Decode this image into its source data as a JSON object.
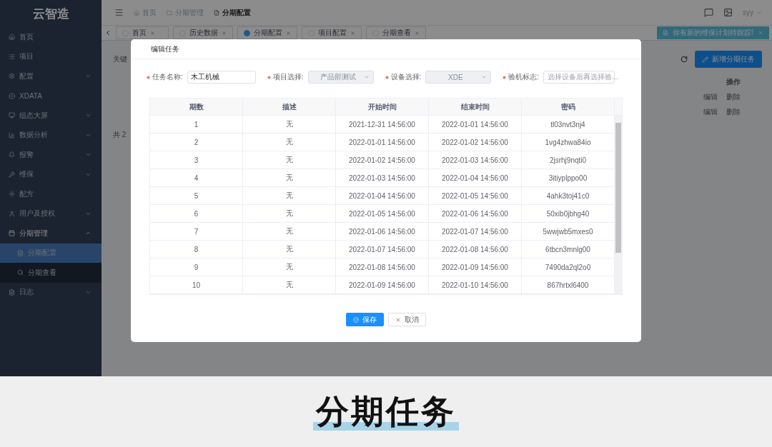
{
  "sidebar": {
    "logo": "云智造",
    "items": [
      {
        "label": "首页",
        "kind": "link"
      },
      {
        "label": "项目",
        "kind": "link"
      },
      {
        "label": "配置",
        "kind": "group",
        "expanded": false
      },
      {
        "label": "XDATA",
        "kind": "link"
      },
      {
        "label": "组态大屏",
        "kind": "group",
        "expanded": false
      },
      {
        "label": "数据分析",
        "kind": "group",
        "expanded": false
      },
      {
        "label": "报警",
        "kind": "group",
        "expanded": false
      },
      {
        "label": "维保",
        "kind": "group",
        "expanded": false
      },
      {
        "label": "配方",
        "kind": "link"
      },
      {
        "label": "用户及授权",
        "kind": "group",
        "expanded": false
      },
      {
        "label": "分期管理",
        "kind": "group",
        "expanded": true,
        "children": [
          {
            "label": "分期配置",
            "selected": true
          },
          {
            "label": "分期查看",
            "selected": false
          }
        ]
      },
      {
        "label": "日志",
        "kind": "group",
        "expanded": false
      }
    ]
  },
  "breadcrumb": [
    "首页",
    "分期管理",
    "分期配置"
  ],
  "user": {
    "name": "syy"
  },
  "tabs": [
    {
      "label": "首页",
      "selected": false
    },
    {
      "label": "历史数据",
      "selected": false
    },
    {
      "label": "分期配置",
      "selected": true
    },
    {
      "label": "项目配置",
      "selected": false
    },
    {
      "label": "分期查看",
      "selected": false
    }
  ],
  "notification": {
    "text": "你有新的维保计划待跟踪!"
  },
  "page": {
    "keyword_label": "关键",
    "add_button": "新增分期任务",
    "action_column": "操作",
    "rows": [
      {
        "actions": [
          "编辑",
          "删除"
        ]
      },
      {
        "actions": [
          "编辑",
          "删除"
        ]
      }
    ],
    "total": "共 2"
  },
  "dialog": {
    "title": "编辑任务",
    "fields": [
      {
        "label": "任务名称:",
        "kind": "input",
        "required": true,
        "value": "木工机械"
      },
      {
        "label": "项目选择:",
        "kind": "select",
        "required": true,
        "value": "产品部测试",
        "disabled": true
      },
      {
        "label": "设备选择:",
        "kind": "select",
        "required": true,
        "value": "XDE",
        "disabled": true
      },
      {
        "label": "验机标志:",
        "kind": "select",
        "required": true,
        "placeholder": "选择设备后再选择验...",
        "disabled": false
      }
    ],
    "table": {
      "columns": [
        "期数",
        "描述",
        "开始时间",
        "结束时间",
        "密码"
      ],
      "rows": [
        [
          "1",
          "无",
          "2021-12-31 14:56:00",
          "2022-01-01 14:56:00",
          "tl03nvt3nj4"
        ],
        [
          "2",
          "无",
          "2022-01-01 14:56:00",
          "2022-01-02 14:56:00",
          "1vg4zhwa84io"
        ],
        [
          "3",
          "无",
          "2022-01-02 14:56:00",
          "2022-01-03 14:56:00",
          "2jsrhj9nqti0"
        ],
        [
          "4",
          "无",
          "2022-01-03 14:56:00",
          "2022-01-04 14:56:00",
          "3itiyplppo00"
        ],
        [
          "5",
          "无",
          "2022-01-04 14:56:00",
          "2022-01-05 14:56:00",
          "4ahk3toj41c0"
        ],
        [
          "6",
          "无",
          "2022-01-05 14:56:00",
          "2022-01-06 14:56:00",
          "50xib0jbhg40"
        ],
        [
          "7",
          "无",
          "2022-01-06 14:56:00",
          "2022-01-07 14:56:00",
          "5wwjwb5mxes0"
        ],
        [
          "8",
          "无",
          "2022-01-07 14:56:00",
          "2022-01-08 14:56:00",
          "6tbcn3mnlg00"
        ],
        [
          "9",
          "无",
          "2022-01-08 14:56:00",
          "2022-01-09 14:56:00",
          "7490da2ql2o0"
        ],
        [
          "10",
          "无",
          "2022-01-09 14:56:00",
          "2022-01-10 14:56:00",
          "867hrtxl6400"
        ]
      ]
    },
    "buttons": [
      {
        "label": "保存",
        "kind": "primary"
      },
      {
        "label": "取消",
        "kind": "default"
      }
    ]
  },
  "caption": "分期任务"
}
